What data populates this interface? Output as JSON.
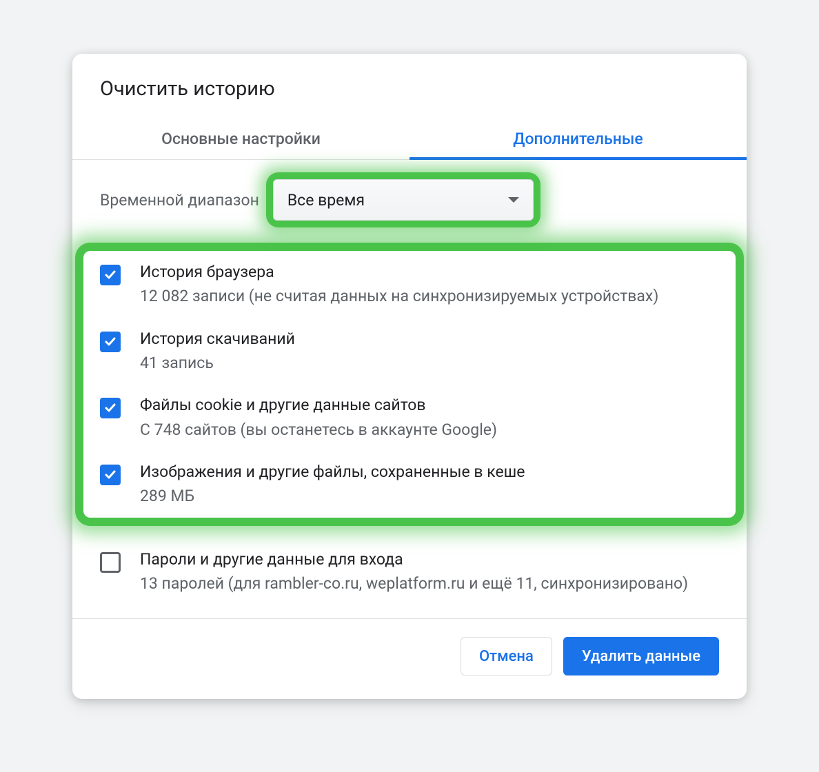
{
  "dialog": {
    "title": "Очистить историю",
    "tabs": {
      "basic": "Основные настройки",
      "advanced": "Дополнительные"
    },
    "range": {
      "label": "Временной диапазон",
      "selected": "Все время"
    },
    "items": [
      {
        "checked": true,
        "title": "История браузера",
        "sub": "12 082 записи (не считая данных на синхронизируемых устройствах)"
      },
      {
        "checked": true,
        "title": "История скачиваний",
        "sub": "41 запись"
      },
      {
        "checked": true,
        "title": "Файлы cookie и другие данные сайтов",
        "sub": "С 748 сайтов (вы останетесь в аккаунте Google)"
      },
      {
        "checked": true,
        "title": "Изображения и другие файлы, сохраненные в кеше",
        "sub": "289 МБ"
      },
      {
        "checked": false,
        "title": "Пароли и другие данные для входа",
        "sub": "13 паролей (для rambler-co.ru, weplatform.ru и ещё 11, синхронизировано)"
      }
    ],
    "buttons": {
      "cancel": "Отмена",
      "confirm": "Удалить данные"
    }
  },
  "colors": {
    "accent": "#1a73e8",
    "highlight": "#3cc03c"
  }
}
